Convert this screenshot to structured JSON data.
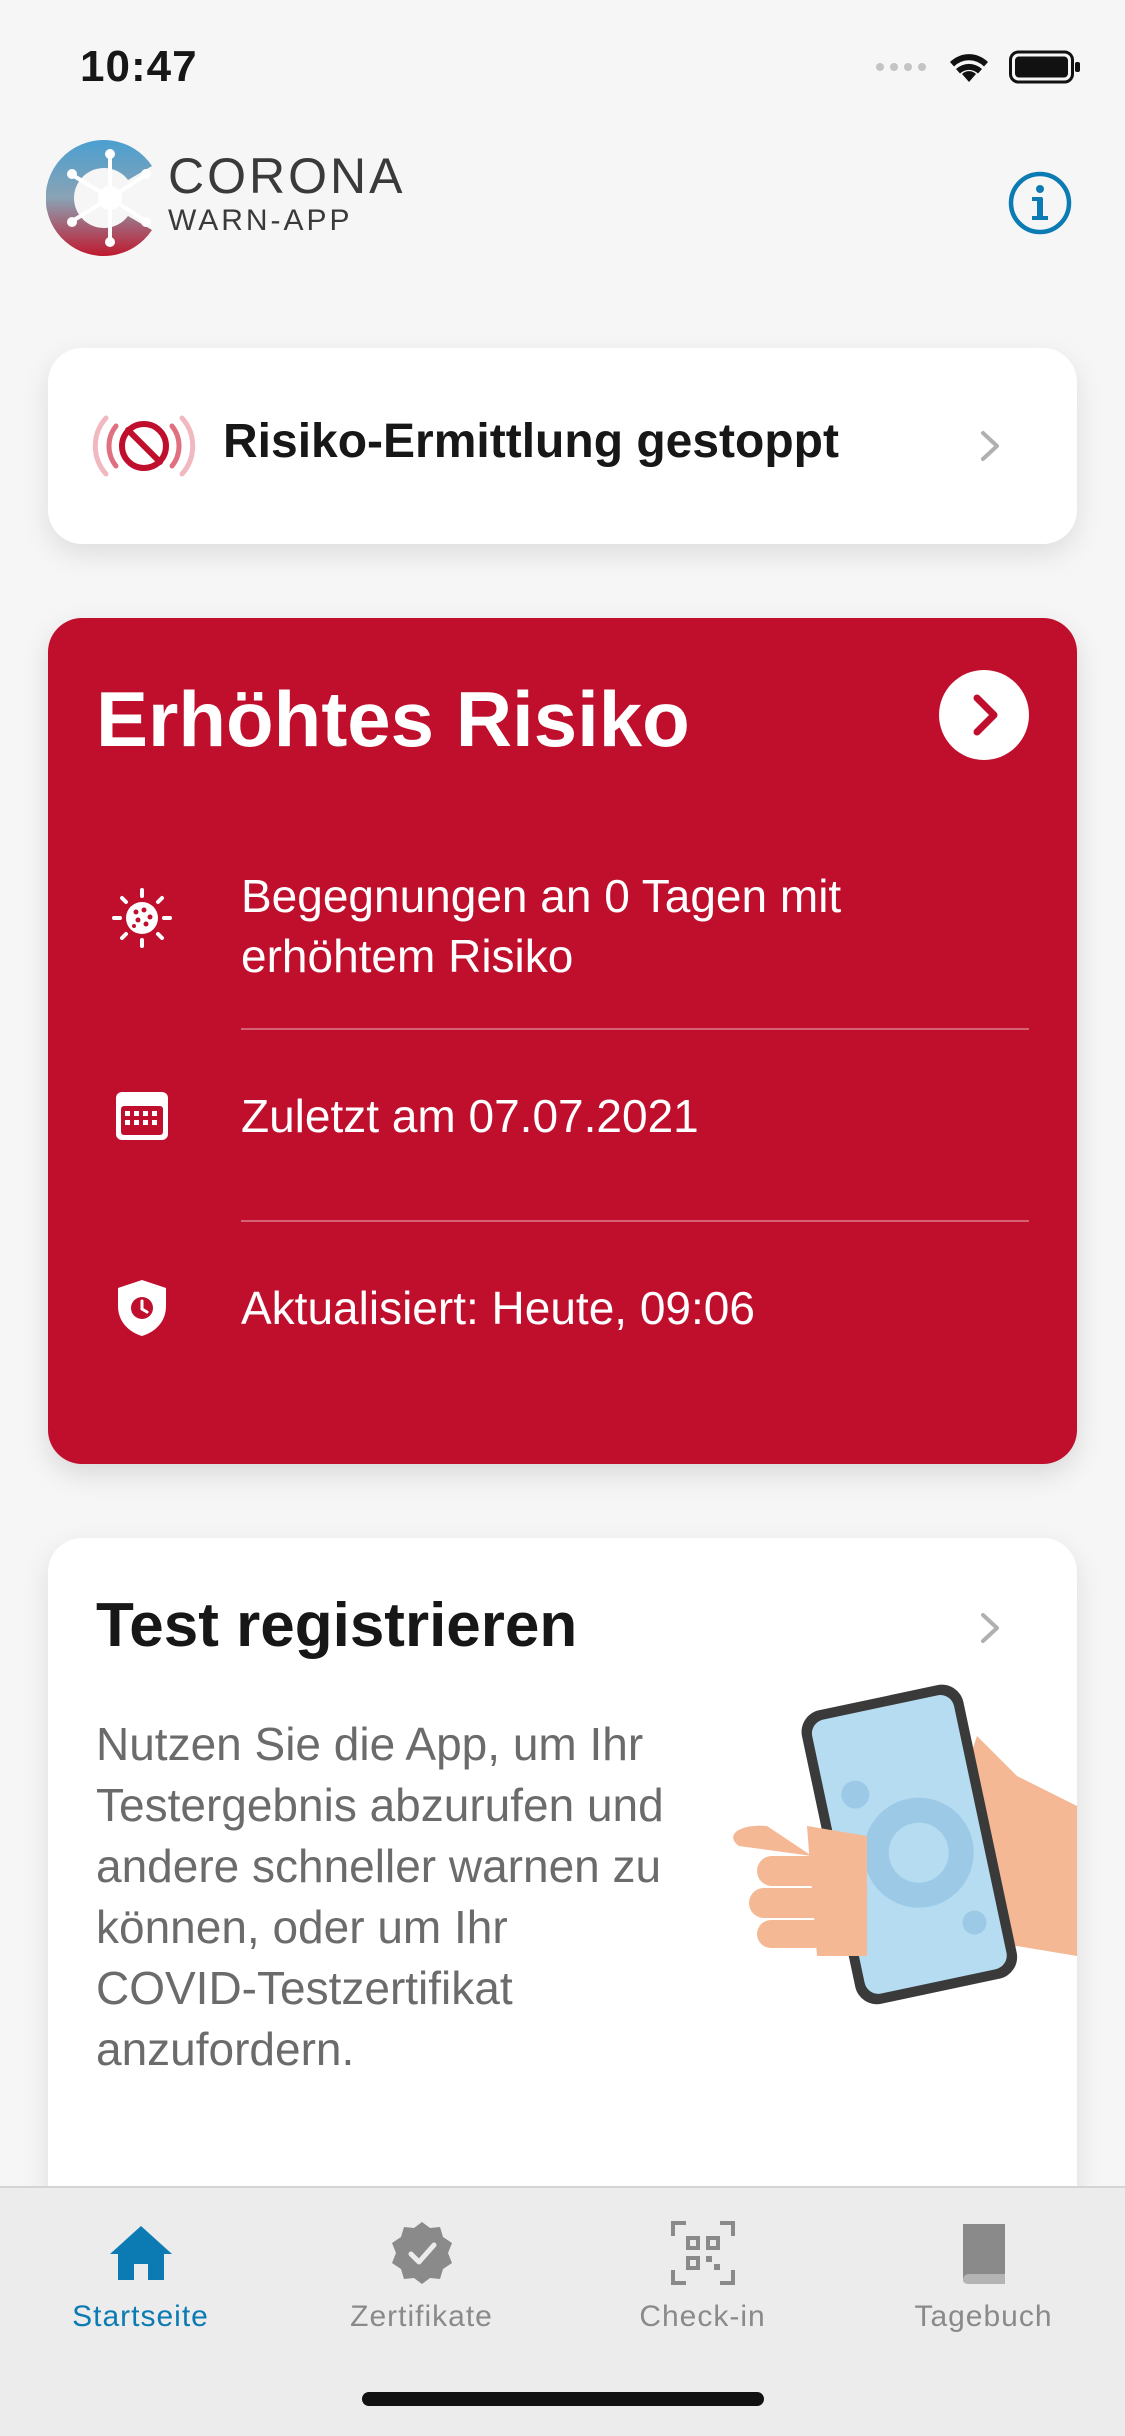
{
  "status_bar": {
    "time": "10:47",
    "icons": [
      "signal-icon",
      "wifi-icon",
      "battery-icon"
    ]
  },
  "header": {
    "brand_line1": "CORONA",
    "brand_line2": "WARN-APP",
    "info_icon": "info-icon"
  },
  "stopped_card": {
    "label": "Risiko-Ermittlung gestoppt",
    "icon": "exposure-stopped-icon"
  },
  "risk_card": {
    "title": "Erhöhtes Risiko",
    "rows": [
      {
        "icon": "virus-icon",
        "text": "Begegnungen an 0 Tagen mit erhöhtem Risiko"
      },
      {
        "icon": "calendar-icon",
        "text": "Zuletzt am 07.07.2021"
      },
      {
        "icon": "shield-clock-icon",
        "text": "Aktualisiert: Heute, 09:06"
      }
    ],
    "color": "#c00f2d"
  },
  "test_card": {
    "title": "Test registrieren",
    "body": "Nutzen Sie die App, um Ihr Testergebnis abzurufen und andere schneller warnen zu können, oder um Ihr COVID-Testzertifikat anzufordern."
  },
  "tab_bar": {
    "tabs": [
      {
        "label": "Startseite",
        "icon": "home-icon",
        "active": true
      },
      {
        "label": "Zertifikate",
        "icon": "certificate-icon",
        "active": false
      },
      {
        "label": "Check-in",
        "icon": "qr-code-icon",
        "active": false
      },
      {
        "label": "Tagebuch",
        "icon": "book-icon",
        "active": false
      }
    ],
    "active_color": "#0c7bb3",
    "inactive_color": "#8a8a8a"
  }
}
